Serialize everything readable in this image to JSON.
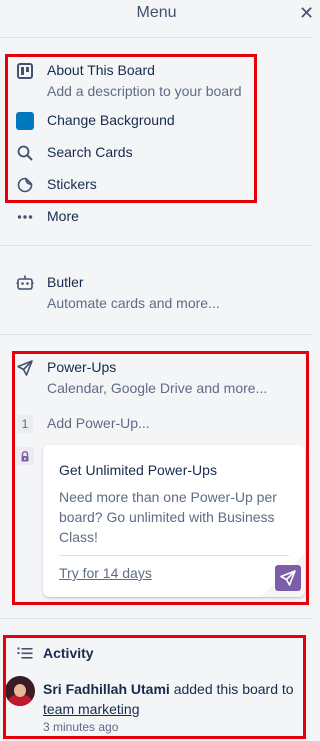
{
  "header": {
    "title": "Menu",
    "close_glyph": "✕"
  },
  "menu": {
    "about": {
      "label": "About This Board",
      "sub": "Add a description to your board",
      "icon": "board-icon"
    },
    "background": {
      "label": "Change Background",
      "color": "#0079bf"
    },
    "search": {
      "label": "Search Cards",
      "icon": "search-icon"
    },
    "stickers": {
      "label": "Stickers",
      "icon": "sticker-icon"
    },
    "more": {
      "label": "More",
      "icon": "ellipsis-icon"
    }
  },
  "butler": {
    "label": "Butler",
    "sub": "Automate cards and more...",
    "icon": "robot-icon"
  },
  "powerups": {
    "label": "Power-Ups",
    "sub": "Calendar, Google Drive and more...",
    "count": "1",
    "add_label": "Add Power-Up...",
    "card": {
      "title": "Get Unlimited Power-Ups",
      "body": "Need more than one Power-Up per board? Go unlimited with Business Class!",
      "link": "Try for 14 days",
      "accent": "#7b5ea7"
    }
  },
  "activity": {
    "title": "Activity",
    "user": "Sri Fadhillah Utami",
    "action": " added this board to ",
    "target": "team marketing",
    "time": "3 minutes ago"
  },
  "colors": {
    "highlight": "#e6000a",
    "text": "#172b4d",
    "muted": "#5e6c84",
    "background": "#f4f5f7"
  }
}
